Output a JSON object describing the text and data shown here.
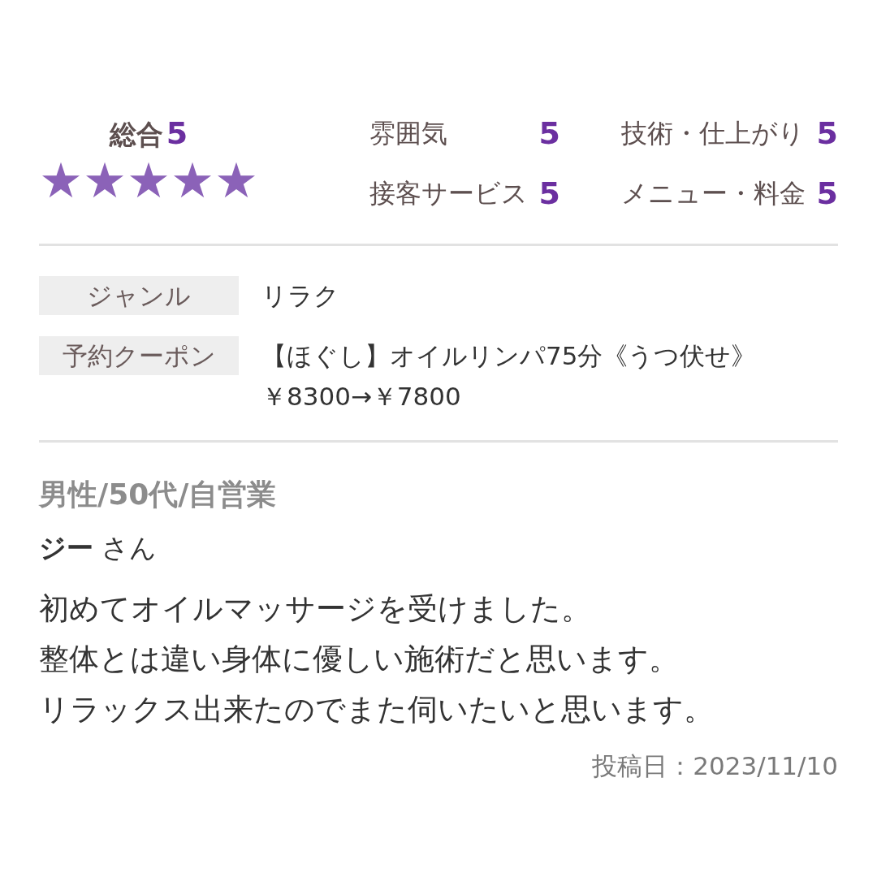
{
  "overall": {
    "label": "総合",
    "score": "5",
    "stars": 5
  },
  "ratings": [
    {
      "label": "雰囲気",
      "score": "5"
    },
    {
      "label": "技術・仕上がり",
      "score": "5"
    },
    {
      "label": "接客サービス",
      "score": "5"
    },
    {
      "label": "メニュー・料金",
      "score": "5"
    }
  ],
  "details": [
    {
      "label": "ジャンル",
      "lines": [
        "リラク"
      ]
    },
    {
      "label": "予約クーポン",
      "lines": [
        "【ほぐし】オイルリンパ75分《うつ伏せ》",
        "￥8300→￥7800"
      ]
    }
  ],
  "reviewer": {
    "profile": "男性/50代/自営業",
    "name": "**ジー** さん"
  },
  "review": {
    "lines": [
      "初めてオイルマッサージを受けました。",
      "整体とは違い身体に優しい施術だと思います。",
      "リラックス出来たのでまた伺いたいと思います。"
    ]
  },
  "posted": "投稿日：2023/11/10"
}
